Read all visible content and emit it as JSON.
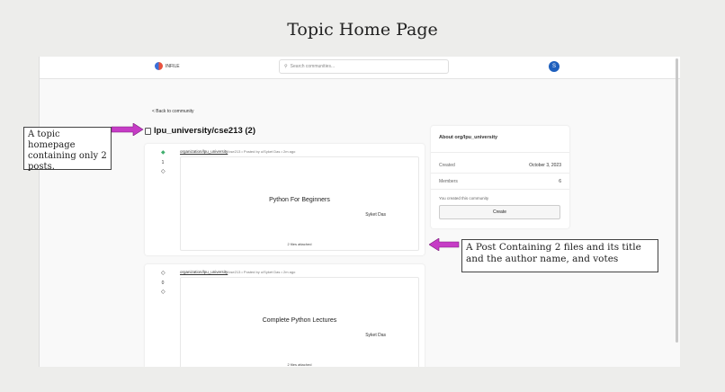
{
  "slide": {
    "title": "Topic Home Page"
  },
  "app": {
    "logo_text": "INFILE",
    "search_placeholder": "Search communities...",
    "avatar_initial": "S",
    "colors": {
      "accent": "#1d5fbd",
      "upvote": "#3fae6d",
      "logo_red": "#e8523f",
      "logo_blue": "#3a6fd8"
    }
  },
  "page": {
    "back_label": "< Back to community",
    "heading": "lpu_university/cse213 (2)"
  },
  "posts": [
    {
      "org": "organization/lpu_university",
      "meta": "/cse213 • Posted by u/Syket Das • 2m ago",
      "votes": "1",
      "title": "Python For Beginners",
      "author": "Syket Das",
      "files": "2 files attached",
      "upvoted": true
    },
    {
      "org": "organization/lpu_university",
      "meta": "/cse213 • Posted by u/Syket Das • 2m ago",
      "votes": "0",
      "title": "Complete Python Lectures",
      "author": "Syket Das",
      "files": "2 files attached",
      "upvoted": false
    }
  ],
  "about": {
    "title": "About org/lpu_university",
    "created_label": "Created",
    "created_value": "October 3, 2023",
    "members_label": "Members",
    "members_value": "6",
    "note": "You created this community",
    "create_label": "Create"
  },
  "annotations": {
    "left": "A topic homepage containing only 2 posts.",
    "right": "A Post Containing 2 files and its title and the author name, and votes",
    "arrow_color": "#c63cc6"
  }
}
